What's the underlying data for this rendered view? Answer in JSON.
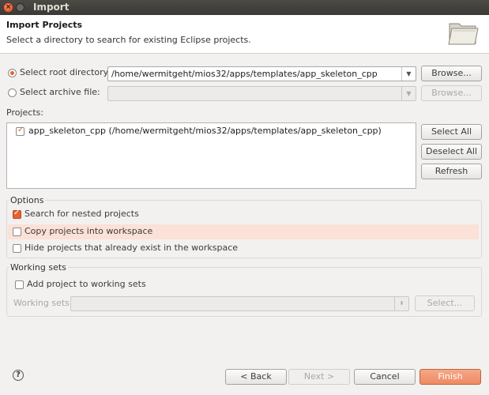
{
  "window": {
    "title": "Import"
  },
  "header": {
    "title": "Import Projects",
    "description": "Select a directory to search for existing Eclipse projects."
  },
  "source": {
    "root_label": "Select root directory:",
    "root_path": "/home/wermitgeht/mios32/apps/templates/app_skeleton_cpp",
    "root_selected": true,
    "archive_label": "Select archive file:",
    "archive_path": "",
    "archive_selected": false,
    "browse_label": "Browse..."
  },
  "projects": {
    "label": "Projects:",
    "items": [
      {
        "name": "app_skeleton_cpp (/home/wermitgeht/mios32/apps/templates/app_skeleton_cpp)",
        "checked": true
      }
    ],
    "select_all": "Select All",
    "deselect_all": "Deselect All",
    "refresh": "Refresh"
  },
  "options": {
    "title": "Options",
    "search_nested": {
      "label": "Search for nested projects",
      "checked": true
    },
    "copy_into_workspace": {
      "label": "Copy projects into workspace",
      "checked": false
    },
    "hide_existing": {
      "label": "Hide projects that already exist in the workspace",
      "checked": false
    }
  },
  "working_sets": {
    "title": "Working sets",
    "add_label": "Add project to working sets",
    "add_checked": false,
    "sets_label": "Working sets:",
    "sets_value": "",
    "select_label": "Select..."
  },
  "footer": {
    "back": "< Back",
    "next": "Next >",
    "cancel": "Cancel",
    "finish": "Finish"
  },
  "colors": {
    "accent": "#e6632f",
    "highlight_row": "#fbe1d7"
  },
  "icons": {
    "help": "help-icon",
    "header_image": "folder-open-icon",
    "close": "close-icon"
  }
}
